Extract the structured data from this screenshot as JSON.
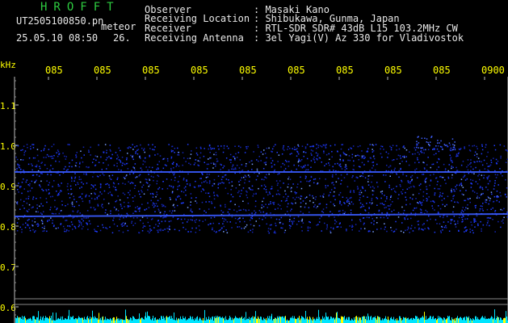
{
  "header": {
    "brand": "HROFFT",
    "filename": "UT2505100850.pn",
    "meteor_label": "meteor",
    "datetime": "25.05.10 08:50",
    "count": "26."
  },
  "info": {
    "labels": [
      "Observer",
      "Receiving Location",
      "Receiver",
      "Receiving Antenna"
    ],
    "values": [
      ": Masaki Kano",
      ": Shibukawa, Gunma, Japan",
      ": RTL-SDR SDR# 43dB L15 103.2MHz CW",
      ": 3el Yagi(V) Az 330 for Vladivostok"
    ]
  },
  "axes": {
    "y_unit": "kHz",
    "y_ticks": [
      "1.1",
      "1.0",
      "0.9",
      "0.8",
      "0.7",
      "0.6"
    ],
    "x_ticks": [
      "085",
      "085",
      "085",
      "085",
      "085",
      "085",
      "085",
      "085",
      "085",
      "0900"
    ]
  },
  "colors": {
    "text_green": "#2ecc40",
    "text_white": "#e8e8e8",
    "axis_yellow": "#ffff00",
    "signal_blue": "#2244ff",
    "noise_cyan": "#00e5ff"
  }
}
